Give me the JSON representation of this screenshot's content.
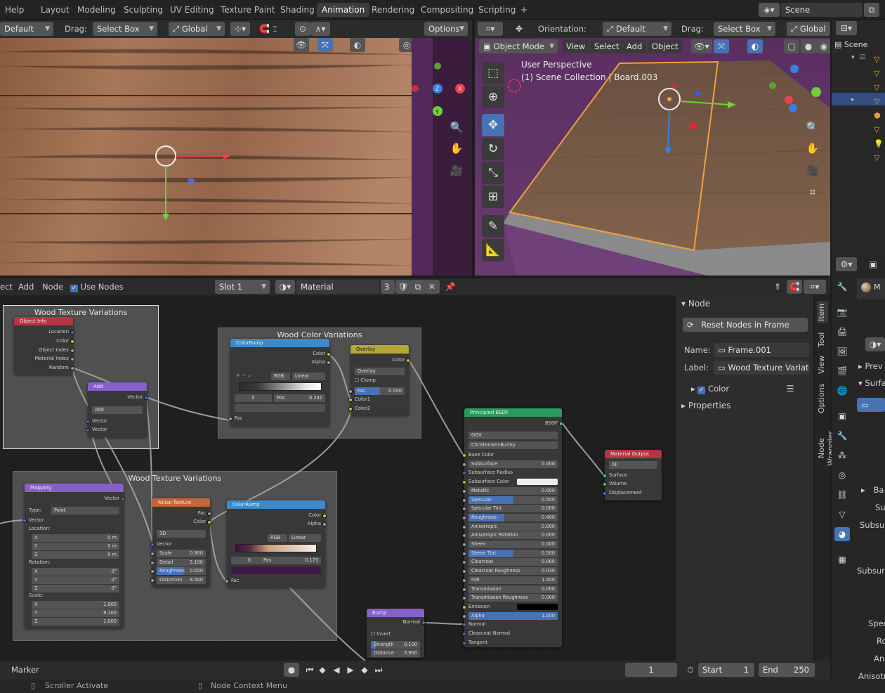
{
  "topbar": {
    "menu_help": "Help",
    "tabs": [
      "Layout",
      "Modeling",
      "Sculpting",
      "UV Editing",
      "Texture Paint",
      "Shading",
      "Animation",
      "Rendering",
      "Compositing",
      "Scripting"
    ],
    "active_tab": "Animation",
    "add_tab": "+",
    "scene_name": "Scene"
  },
  "uv_header": {
    "mode": "Default",
    "drag_label": "Drag:",
    "drag_value": "Select Box",
    "transform": "Global",
    "options": "Options"
  },
  "viewport_header": {
    "orientation_label": "Orientation:",
    "orientation_value": "Default",
    "drag_label": "Drag:",
    "drag_value": "Select Box",
    "transform": "Global",
    "mode": "Object Mode",
    "menu": [
      "View",
      "Select",
      "Add",
      "Object"
    ]
  },
  "viewport": {
    "perspective": "User Perspective",
    "collection": "(1) Scene Collection | Board.003"
  },
  "outliner": {
    "title": "Scene"
  },
  "node_header": {
    "menu": [
      "ect",
      "Add",
      "Node"
    ],
    "use_nodes": "Use Nodes",
    "slot": "Slot 1",
    "material": "Material",
    "users": "3"
  },
  "nodes": {
    "frame1": "Wood Texture Variations",
    "frame2": "Wood Color Variations",
    "frame3": "Wood Texture Variations",
    "object_info": {
      "title": "Object Info",
      "outputs": [
        "Location",
        "Color",
        "Object Index",
        "Material Index",
        "Random"
      ]
    },
    "add": {
      "title": "Add",
      "out": "Vector",
      "op": "Add",
      "in": [
        "Vector",
        "Vector"
      ]
    },
    "colorramp1": {
      "title": "ColorRamp",
      "outs": [
        "Color",
        "Alpha"
      ],
      "mode": "RGB",
      "interp": "Linear",
      "index": "0",
      "pos_label": "Pos",
      "pos": "0.241",
      "in": "Fac"
    },
    "overlay": {
      "title": "Overlay",
      "out": "Color",
      "blend": "Overlay",
      "clamp": "Clamp",
      "fac_label": "Fac",
      "fac": "0.500",
      "in": [
        "Color1",
        "Color2"
      ]
    },
    "principled": {
      "title": "Principled BSDF",
      "out": "BSDF",
      "dist": "GGX",
      "sss": "Christensen-Burley",
      "rows": [
        {
          "k": "Base Color",
          "v": ""
        },
        {
          "k": "Subsurface",
          "v": "0.000"
        },
        {
          "k": "Subsurface Radius",
          "v": ""
        },
        {
          "k": "Subsurface Color",
          "v": ""
        },
        {
          "k": "Metallic",
          "v": "0.000"
        },
        {
          "k": "Specular",
          "v": "0.500"
        },
        {
          "k": "Specular Tint",
          "v": "0.000"
        },
        {
          "k": "Roughness",
          "v": "0.400"
        },
        {
          "k": "Anisotropic",
          "v": "0.000"
        },
        {
          "k": "Anisotropic Rotation",
          "v": "0.000"
        },
        {
          "k": "Sheen",
          "v": "0.000"
        },
        {
          "k": "Sheen Tint",
          "v": "0.500"
        },
        {
          "k": "Clearcoat",
          "v": "0.000"
        },
        {
          "k": "Clearcoat Roughness",
          "v": "0.030"
        },
        {
          "k": "IOR",
          "v": "1.450"
        },
        {
          "k": "Transmission",
          "v": "0.000"
        },
        {
          "k": "Transmission Roughness",
          "v": "0.000"
        },
        {
          "k": "Emission",
          "v": ""
        },
        {
          "k": "Alpha",
          "v": "1.000"
        },
        {
          "k": "Normal",
          "v": ""
        },
        {
          "k": "Clearcoat Normal",
          "v": ""
        },
        {
          "k": "Tangent",
          "v": ""
        }
      ]
    },
    "output": {
      "title": "Material Output",
      "target": "All",
      "in": [
        "Surface",
        "Volume",
        "Displacement"
      ]
    },
    "mapping": {
      "title": "Mapping",
      "out": "Vector",
      "type_label": "Type:",
      "type": "Point",
      "in": "Vector",
      "loc_label": "Location:",
      "loc": [
        {
          "k": "X",
          "v": "0 m"
        },
        {
          "k": "Y",
          "v": "0 m"
        },
        {
          "k": "Z",
          "v": "0 m"
        }
      ],
      "rot_label": "Rotation:",
      "rot": [
        {
          "k": "X",
          "v": "0°"
        },
        {
          "k": "Y",
          "v": "0°"
        },
        {
          "k": "Z",
          "v": "0°"
        }
      ],
      "scale_label": "Scale:",
      "scale": [
        {
          "k": "X",
          "v": "1.900"
        },
        {
          "k": "Y",
          "v": "8.100"
        },
        {
          "k": "Z",
          "v": "1.000"
        }
      ]
    },
    "noise": {
      "title": "Noise Texture",
      "outs": [
        "Fac",
        "Color"
      ],
      "dim": "3D",
      "in": "Vector",
      "rows": [
        {
          "k": "Scale",
          "v": "0.900"
        },
        {
          "k": "Detail",
          "v": "5.100"
        },
        {
          "k": "Roughness",
          "v": "0.550"
        },
        {
          "k": "Distortion",
          "v": "8.500"
        }
      ]
    },
    "colorramp2": {
      "title": "ColorRamp",
      "outs": [
        "Color",
        "Alpha"
      ],
      "mode": "RGB",
      "interp": "Linear",
      "index": "0",
      "pos_label": "Pos",
      "pos": "0.173",
      "in": "Fac"
    },
    "bump": {
      "title": "Bump",
      "out": "Normal",
      "invert": "Invert",
      "strength_label": "Strength",
      "strength": "0.100",
      "distance_label": "Distance",
      "distance": "3.900"
    }
  },
  "sidebar": {
    "section": "Node",
    "reset": "Reset Nodes in Frame",
    "name_label": "Name:",
    "name": "Frame.001",
    "label_label": "Label:",
    "label": "Wood Texture Variat...",
    "color": "Color",
    "properties": "Properties",
    "tabs": [
      "Item",
      "Tool",
      "View",
      "Options",
      "Node Wrangler"
    ]
  },
  "props": {
    "labels": [
      "Prev",
      "Surfa",
      "Ba",
      "Su",
      "Subsurf",
      "Subsurfa",
      "Spec",
      "Ro",
      "Ani",
      "Anisotro"
    ],
    "material": "M"
  },
  "timeline": {
    "marker": "Marker",
    "frame": "1",
    "start_label": "Start",
    "start": "1",
    "end_label": "End",
    "end": "250"
  },
  "status": {
    "left": "Scroller Activate",
    "mid": "Node Context Menu"
  }
}
